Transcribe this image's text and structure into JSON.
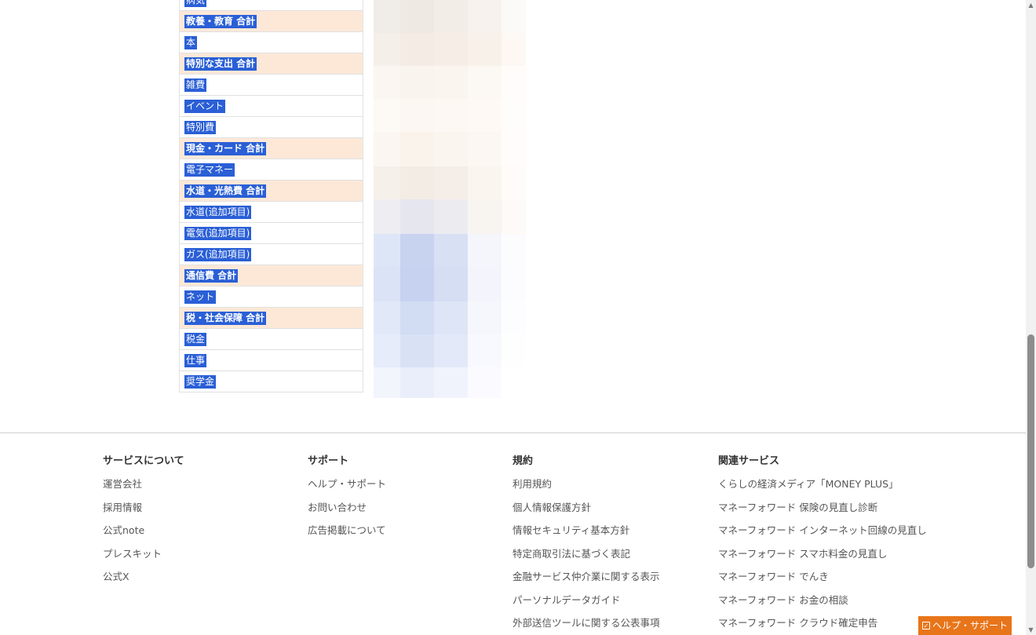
{
  "budget_table": {
    "rows": [
      {
        "label": "病気",
        "total": false
      },
      {
        "label": "教養・教育 合計",
        "total": true
      },
      {
        "label": "本",
        "total": false
      },
      {
        "label": "特別な支出 合計",
        "total": true
      },
      {
        "label": "雑費",
        "total": false
      },
      {
        "label": "イベント",
        "total": false
      },
      {
        "label": "特別費",
        "total": false
      },
      {
        "label": "現金・カード 合計",
        "total": true
      },
      {
        "label": "電子マネー",
        "total": false
      },
      {
        "label": "水道・光熱費 合計",
        "total": true
      },
      {
        "label": "水道(追加項目)",
        "total": false
      },
      {
        "label": "電気(追加項目)",
        "total": false
      },
      {
        "label": "ガス(追加項目)",
        "total": false
      },
      {
        "label": "通信費 合計",
        "total": true
      },
      {
        "label": "ネット",
        "total": false
      },
      {
        "label": "税・社会保障 合計",
        "total": true
      },
      {
        "label": "税金",
        "total": false
      },
      {
        "label": "仕事",
        "total": false
      },
      {
        "label": "奨学金",
        "total": false
      }
    ]
  },
  "footer": {
    "columns": [
      {
        "heading": "サービスについて",
        "links": [
          "運営会社",
          "採用情報",
          "公式note",
          "プレスキット",
          "公式X"
        ]
      },
      {
        "heading": "サポート",
        "links": [
          "ヘルプ・サポート",
          "お問い合わせ",
          "広告掲載について"
        ]
      },
      {
        "heading": "規約",
        "links": [
          "利用規約",
          "個人情報保護方針",
          "情報セキュリティ基本方針",
          "特定商取引法に基づく表記",
          "金融サービス仲介業に関する表示",
          "パーソナルデータガイド",
          "外部送信ツールに関する公表事項"
        ]
      },
      {
        "heading": "関連サービス",
        "links": [
          "くらしの経済メディア「MONEY PLUS」",
          "マネーフォワード 保険の見直し診断",
          "マネーフォワード インターネット回線の見直し",
          "マネーフォワード スマホ料金の見直し",
          "マネーフォワード でんき",
          "マネーフォワード お金の相談",
          "マネーフォワード クラウド確定申告"
        ]
      }
    ]
  },
  "help_button": {
    "label": "ヘルプ・サポート",
    "icon": "check-square-icon",
    "color": "#e8751a"
  },
  "colors": {
    "selection": "#2a5fd6",
    "total_row": "#fde8d8"
  }
}
